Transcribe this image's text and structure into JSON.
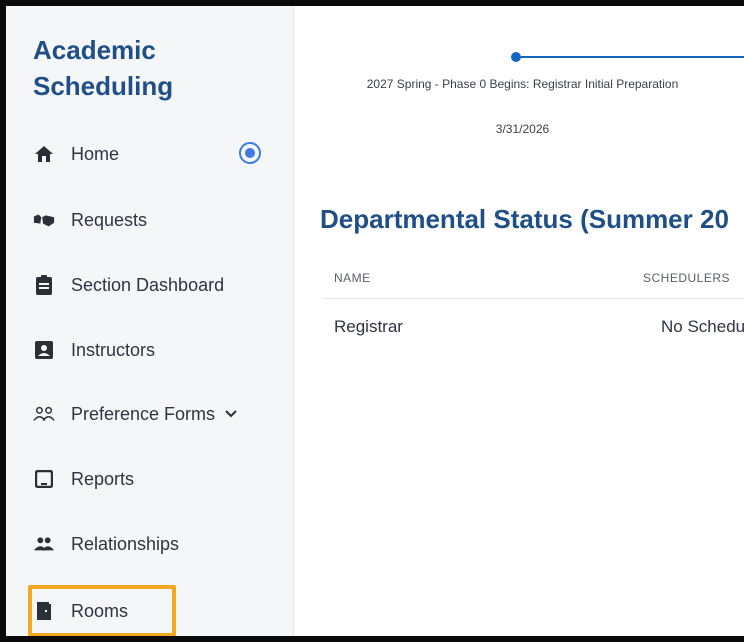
{
  "sidebar": {
    "app_title": "Academic Scheduling",
    "items": [
      {
        "label": "Home",
        "icon": "home-icon"
      },
      {
        "label": "Requests",
        "icon": "handshake-icon"
      },
      {
        "label": "Section Dashboard",
        "icon": "clipboard-icon"
      },
      {
        "label": "Instructors",
        "icon": "id-badge-icon"
      },
      {
        "label": "Preference Forms",
        "icon": "people-outline-icon"
      },
      {
        "label": "Reports",
        "icon": "tablet-icon"
      },
      {
        "label": "Relationships",
        "icon": "people-icon"
      },
      {
        "label": "Rooms",
        "icon": "door-icon"
      }
    ]
  },
  "timeline": {
    "milestone_title": "2027 Spring - Phase 0 Begins: Registrar Initial Preparation",
    "milestone_date": "3/31/2026"
  },
  "departmental": {
    "heading": "Departmental Status (Summer 20",
    "columns": [
      "NAME",
      "SCHEDULERS"
    ],
    "rows": [
      {
        "name": "Registrar",
        "schedulers": "No Schedul"
      }
    ]
  },
  "colors": {
    "accent_blue": "#1f4f86",
    "timeline_blue": "#1565c0",
    "highlight_orange": "#f5a623"
  }
}
